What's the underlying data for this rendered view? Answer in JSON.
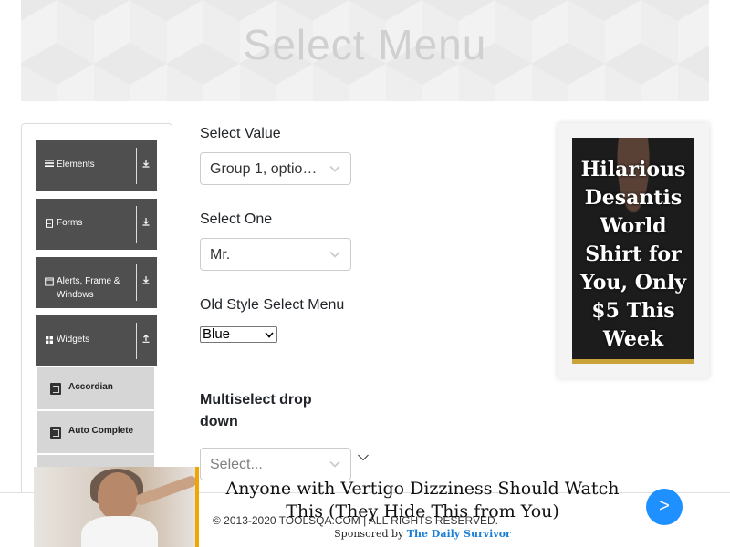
{
  "banner": {
    "title": "Select Menu"
  },
  "sidebar": {
    "groups": [
      {
        "label": "Elements",
        "icon": "list-icon",
        "arrow": "download-icon"
      },
      {
        "label": "Forms",
        "icon": "form-icon",
        "arrow": "download-icon"
      },
      {
        "label": "Alerts, Frame & Windows",
        "icon": "window-icon",
        "arrow": "download-icon"
      },
      {
        "label": "Widgets",
        "icon": "grid-icon",
        "arrow": "upload-icon"
      }
    ],
    "subitems": [
      {
        "label": "Accordian",
        "icon": "html5-icon"
      },
      {
        "label": "Auto Complete",
        "icon": "html5-icon"
      }
    ]
  },
  "form": {
    "select_value": {
      "label": "Select Value",
      "value": "Group 1, option 1"
    },
    "select_one": {
      "label": "Select One",
      "value": "Mr."
    },
    "old_style": {
      "label": "Old Style Select Menu",
      "value": "Blue"
    },
    "multiselect": {
      "label_line1": "Multiselect drop",
      "label_line2": "down",
      "placeholder": "Select..."
    }
  },
  "ad_side": {
    "text": "Hilarious Desantis World Shirt for You, Only $5 This Week"
  },
  "footer": {
    "copyright": "© 2013-2020 TOOLSQA.COM | ALL RIGHTS RESERVED."
  },
  "ad_bottom": {
    "headline": "Anyone with Vertigo Dizziness Should Watch This (They Hide This from You)",
    "sponsored_by": "Sponsored by",
    "sponsor": "The Daily Survivor",
    "next_label": ">"
  },
  "colors": {
    "group_bg": "#4f4f4f",
    "subitem_bg": "#d6d6d6",
    "next_button": "#1e90ff",
    "ad_accent": "#f0a500"
  }
}
